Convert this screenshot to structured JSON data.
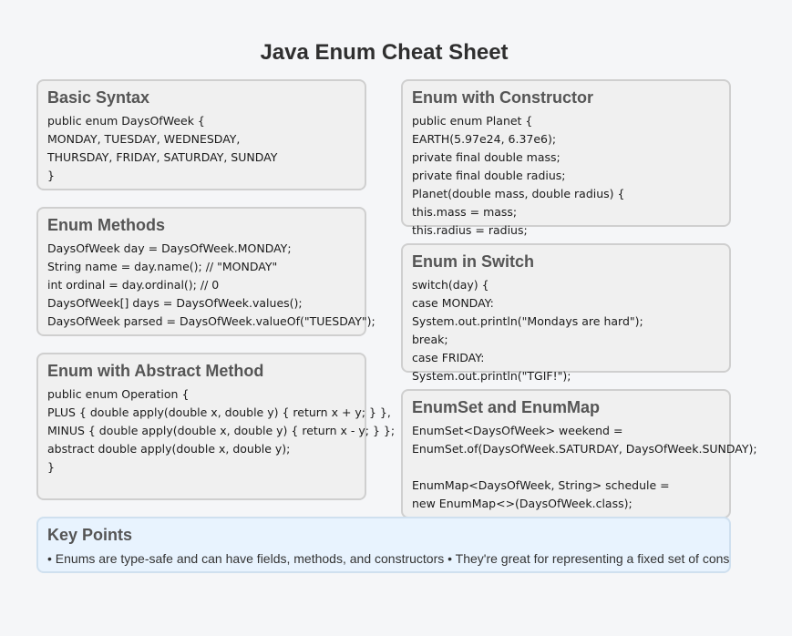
{
  "title": "Java Enum Cheat Sheet",
  "cards": {
    "basic_syntax": {
      "heading": "Basic Syntax",
      "lines": [
        "public enum DaysOfWeek {",
        "MONDAY, TUESDAY, WEDNESDAY,",
        "THURSDAY, FRIDAY, SATURDAY, SUNDAY",
        "}"
      ]
    },
    "enum_methods": {
      "heading": "Enum Methods",
      "lines": [
        "DaysOfWeek day = DaysOfWeek.MONDAY;",
        "String name = day.name(); // \"MONDAY\"",
        "int ordinal = day.ordinal(); // 0",
        "DaysOfWeek[] days = DaysOfWeek.values();",
        "DaysOfWeek parsed = DaysOfWeek.valueOf(\"TUESDAY\");"
      ]
    },
    "abstract_method": {
      "heading": "Enum with Abstract Method",
      "lines": [
        "public enum Operation {",
        "PLUS { double apply(double x, double y) { return x + y; } },",
        "MINUS { double apply(double x, double y) { return x - y; } };",
        "abstract double apply(double x, double y);",
        "}"
      ]
    },
    "constructor": {
      "heading": "Enum with Constructor",
      "lines": [
        "public enum Planet {",
        "EARTH(5.97e24, 6.37e6);",
        "private final double mass;",
        "private final double radius;",
        "Planet(double mass, double radius) {",
        "this.mass = mass;",
        "this.radius = radius;"
      ]
    },
    "switch": {
      "heading": "Enum in Switch",
      "lines": [
        "switch(day) {",
        "case MONDAY:",
        "System.out.println(\"Mondays are hard\");",
        "break;",
        "case FRIDAY:",
        "System.out.println(\"TGIF!\");"
      ]
    },
    "enumset": {
      "heading": "EnumSet and EnumMap",
      "lines": [
        "EnumSet<DaysOfWeek> weekend =",
        "EnumSet.of(DaysOfWeek.SATURDAY, DaysOfWeek.SUNDAY);",
        "",
        "EnumMap<DaysOfWeek, String> schedule =",
        "new EnumMap<>(DaysOfWeek.class);"
      ]
    },
    "key_points": {
      "heading": "Key Points",
      "text": "• Enums are type-safe and can have fields, methods, and constructors • They're great for representing a fixed set of consta"
    }
  }
}
